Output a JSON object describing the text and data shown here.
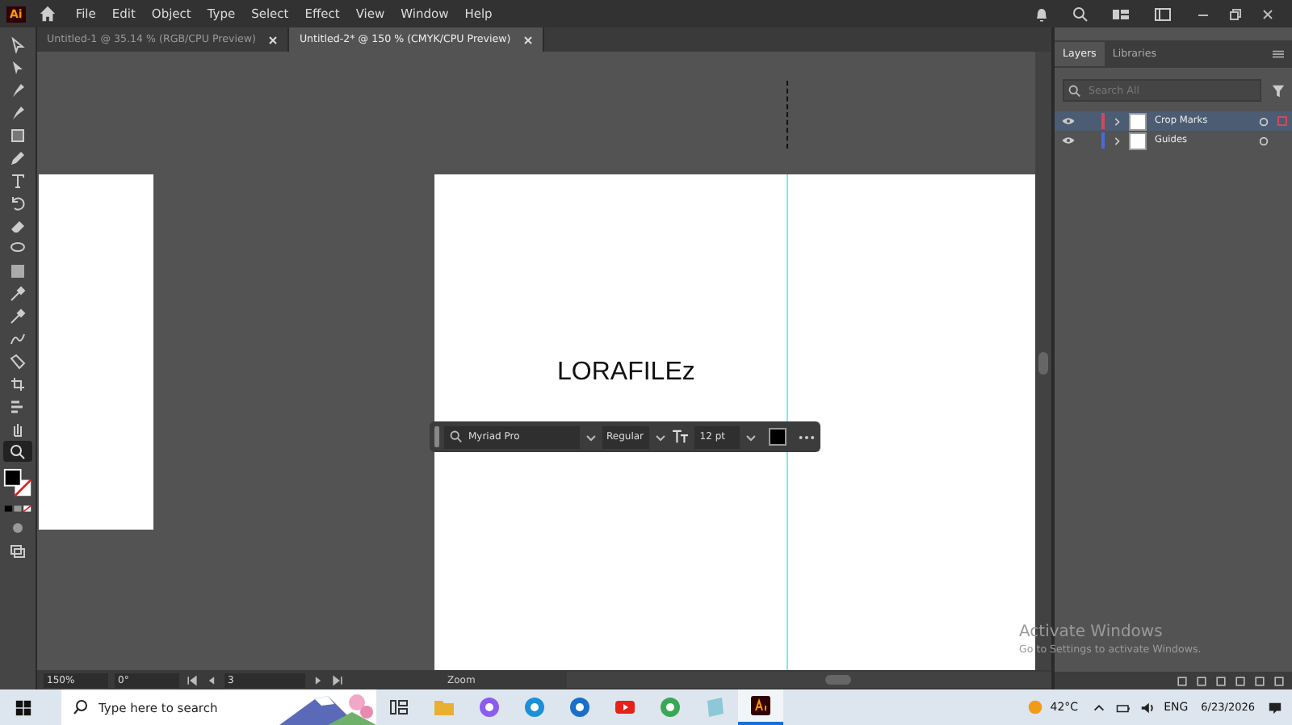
{
  "menu": [
    "File",
    "Edit",
    "Object",
    "Type",
    "Select",
    "Effect",
    "View",
    "Window",
    "Help"
  ],
  "app_badge": "Ai",
  "doc_tabs": [
    {
      "label": "Untitled-1 @ 35.14 % (RGB/CPU Preview)",
      "selected": false
    },
    {
      "label": "Untitled-2* @ 150 % (CMYK/CPU Preview)",
      "selected": true
    }
  ],
  "tools": [
    {
      "selected": false
    },
    {
      "selected": false
    },
    {
      "selected": false
    },
    {
      "selected": false
    },
    {
      "selected": false
    },
    {
      "selected": false
    },
    {
      "selected": false
    },
    {
      "selected": false
    },
    {
      "selected": false
    },
    {
      "selected": false
    },
    {
      "selected": false
    },
    {
      "selected": false
    },
    {
      "selected": false
    },
    {
      "selected": false
    },
    {
      "selected": false
    },
    {
      "selected": false
    },
    {
      "selected": false
    },
    {
      "selected": false
    },
    {
      "selected": true
    }
  ],
  "canvas_text": "LORAFILEz",
  "context_bar": {
    "font": "Myriad Pro",
    "style": "Regular",
    "size": "12 pt"
  },
  "panel": {
    "tabs": [
      {
        "label": "Layers",
        "selected": true
      },
      {
        "label": "Libraries",
        "selected": false
      }
    ],
    "search": {
      "placeholder": "Search All"
    },
    "layers": [
      {
        "name": "Crop Marks",
        "color": "#d04a5a",
        "selected": true,
        "visible": true
      },
      {
        "name": "Guides",
        "color": "#4a6ad8",
        "selected": false,
        "visible": true
      }
    ]
  },
  "status": {
    "zoom": "150%",
    "rotation": "0°",
    "artboard": "3",
    "tool": "Zoom"
  },
  "activation": {
    "title": "Activate Windows",
    "text": "Go to Settings to activate Windows."
  },
  "taskbar": {
    "search": {
      "placeholder": "Type here to search"
    },
    "apps": [
      {
        "kind": "taskview",
        "active": false
      },
      {
        "kind": "folder",
        "active": false
      },
      {
        "kind": "copilot",
        "active": false
      },
      {
        "kind": "edge",
        "active": false
      },
      {
        "kind": "outlook",
        "active": false
      },
      {
        "kind": "youtube",
        "active": false
      },
      {
        "kind": "chrome",
        "active": false
      },
      {
        "kind": "notes",
        "active": false
      },
      {
        "kind": "illustrator",
        "active": true
      }
    ],
    "weather": "42°C",
    "language": "ENG",
    "date": "6/23/2026"
  }
}
